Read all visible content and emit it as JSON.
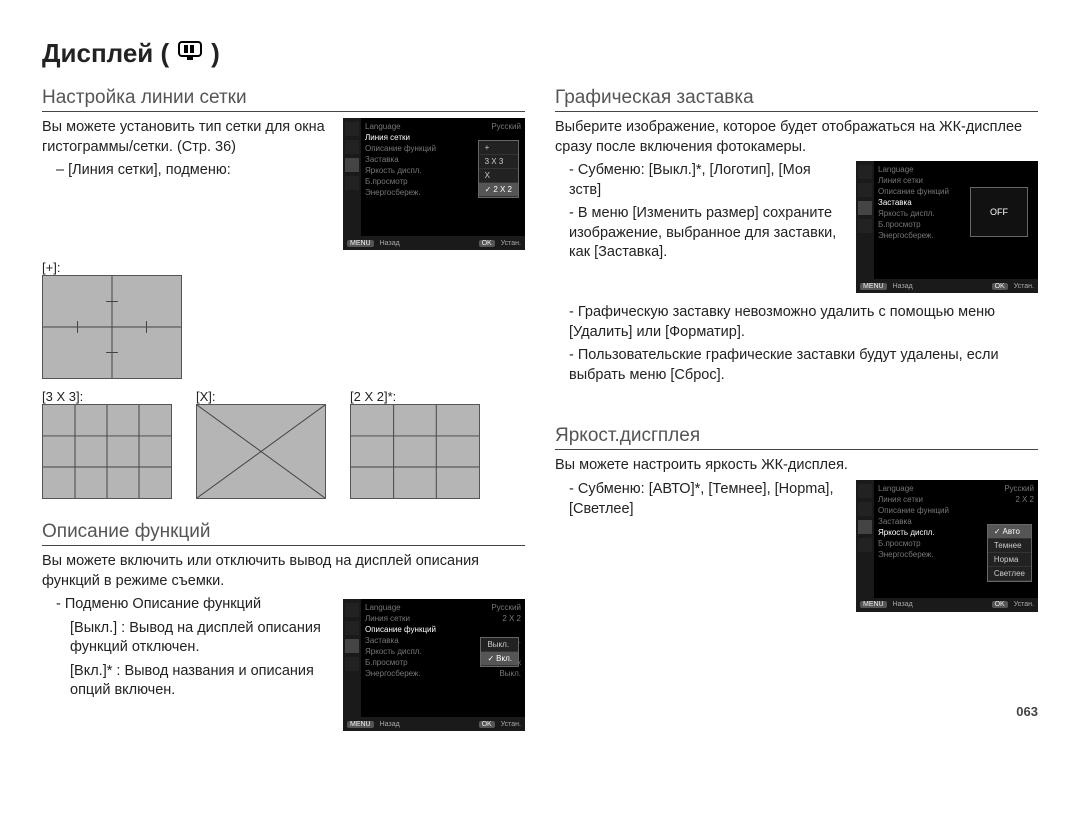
{
  "title_prefix": "Дисплей (",
  "title_suffix": ")",
  "page_number": "063",
  "sections": {
    "grid_line": {
      "title": "Настройка линии сетки",
      "text1": "Вы можете установить тип сетки для окна гистограммы/сетки. (Стр. 36)",
      "submenu_intro": "– [Линия сетки], подменю:",
      "labels": {
        "plus": "[+]:",
        "g3x3": "[3 X 3]:",
        "gx": "[X]:",
        "g2x2": "[2 X 2]*:"
      }
    },
    "func_desc": {
      "title": "Описание функций",
      "text1": "Вы можете включить или отключить вывод на дисплей описания функций в режиме съемки.",
      "sub_intro": "- Подменю Описание функций",
      "off_row": "[Выкл.] : Вывод на дисплей описания функций отключен.",
      "on_row": "[Вкл.]*  : Вывод названия и описания опций включен."
    },
    "start_image": {
      "title": "Графическая заставка",
      "text1": "Выберите изображение, которое будет отображаться на ЖК-дисплее сразу после включения фотокамеры.",
      "sub_intro": "- Субменю: [Выкл.]*, [Логотип], [Моя зств]",
      "bullet2": "- В меню [Изменить размер] сохраните изображение, выбранное для заставки, как [Заставка].",
      "bullet3": "- Графическую заставку невозможно удалить с помощью меню [Удалить] или [Форматир].",
      "bullet4": "- Пользовательские графические заставки будут удалены, если выбрать меню [Сброс]."
    },
    "brightness": {
      "title": "Яркост.дисгплея",
      "text1": "Вы можете настроить яркость ЖК-дисплея.",
      "sub_intro": "- Субменю: [АВТО]*, [Темнее], [Норmа], [Светлее]"
    }
  },
  "ui_common": {
    "menu_items": {
      "language": "Language",
      "grid": "Линия сетки",
      "func": "Описание функций",
      "start": "Заставка",
      "bright": "Яркость диспл.",
      "quick": "Б.просмотр",
      "psave": "Энергосбереж."
    },
    "vals": {
      "lang": "Русский",
      "g2x2": "2 X 2",
      "off": "Выкл.",
      "sec": "0.5 сек",
      "psoff": "Выкл."
    },
    "footer_back": "Назад",
    "footer_set": "Устан.",
    "menu_btn": "MENU",
    "ok_btn": "OK"
  },
  "popup_grid": {
    "opts": [
      "+",
      "3 X 3",
      "X",
      "2 X 2"
    ],
    "sel_idx": 3
  },
  "popup_func": {
    "opts": [
      "Выкл.",
      "Вкл."
    ],
    "sel_idx": 1
  },
  "popup_start": {
    "label": "OFF"
  },
  "popup_bright": {
    "opts": [
      "Авто",
      "Темнее",
      "Норма",
      "Светлее"
    ],
    "sel_idx": 0
  }
}
